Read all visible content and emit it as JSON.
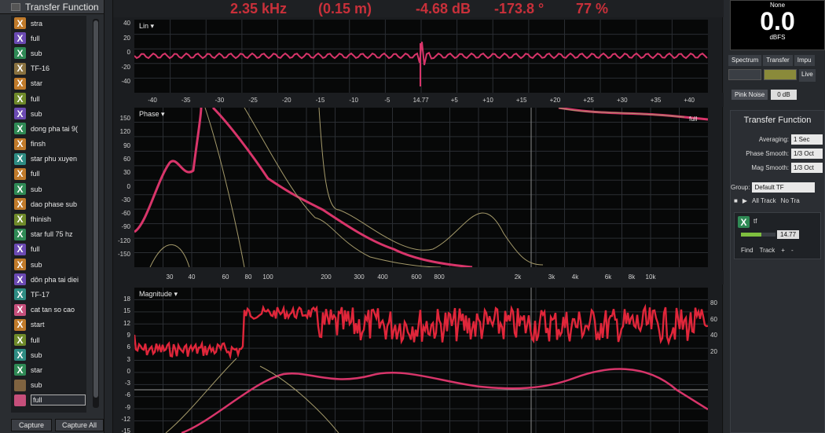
{
  "left_panel": {
    "title": "Transfer Function",
    "items": [
      {
        "icon": "X",
        "label": "stra",
        "color": "c-orange"
      },
      {
        "icon": "X",
        "label": "full",
        "color": "c-violet"
      },
      {
        "icon": "X",
        "label": "sub",
        "color": "c-green"
      },
      {
        "icon": "X",
        "label": "TF-16",
        "color": "c-sand"
      },
      {
        "icon": "X",
        "label": "star",
        "color": "c-orange"
      },
      {
        "icon": "X",
        "label": "full",
        "color": "c-olive"
      },
      {
        "icon": "X",
        "label": "sub",
        "color": "c-violet"
      },
      {
        "icon": "X",
        "label": "dong pha tai 9(",
        "color": "c-green"
      },
      {
        "icon": "X",
        "label": "finsh",
        "color": "c-orange"
      },
      {
        "icon": "X",
        "label": "star phu xuyen",
        "color": "c-teal"
      },
      {
        "icon": "X",
        "label": "full",
        "color": "c-orange"
      },
      {
        "icon": "X",
        "label": "sub",
        "color": "c-green"
      },
      {
        "icon": "X",
        "label": "dao phase sub",
        "color": "c-orange"
      },
      {
        "icon": "X",
        "label": "fhinish",
        "color": "c-olive"
      },
      {
        "icon": "X",
        "label": "star full 75 hz",
        "color": "c-green"
      },
      {
        "icon": "X",
        "label": "full",
        "color": "c-violet"
      },
      {
        "icon": "X",
        "label": "sub",
        "color": "c-orange"
      },
      {
        "icon": "X",
        "label": "dôn pha tai diei",
        "color": "c-violet"
      },
      {
        "icon": "X",
        "label": "TF-17",
        "color": "c-teal"
      },
      {
        "icon": "X",
        "label": "cat tan so cao",
        "color": "c-pink"
      },
      {
        "icon": "X",
        "label": "start",
        "color": "c-orange"
      },
      {
        "icon": "X",
        "label": "full",
        "color": "c-olive"
      },
      {
        "icon": "X",
        "label": "sub",
        "color": "c-teal"
      },
      {
        "icon": "X",
        "label": "star",
        "color": "c-green"
      },
      {
        "icon": "",
        "label": "sub",
        "color": "c-brown"
      },
      {
        "icon": "",
        "label": "full",
        "color": "c-pink",
        "selected": true
      }
    ],
    "capture_label": "Capture",
    "capture_all_label": "Capture All"
  },
  "readout": {
    "freq": "2.35 kHz",
    "dist": "(0.15 m)",
    "mag": "-4.68 dB",
    "phase": "-173.8 °",
    "coherence": "77 %"
  },
  "impulse": {
    "label": "Lin ▾",
    "y_ticks": [
      "40",
      "20",
      "0",
      "-20",
      "-40"
    ],
    "x_ticks": [
      "-40",
      "-35",
      "-30",
      "-25",
      "-20",
      "-15",
      "-10",
      "-5",
      "14.77",
      "+5",
      "+10",
      "+15",
      "+20",
      "+25",
      "+30",
      "+35",
      "+40"
    ]
  },
  "phase": {
    "label": "Phase ▾",
    "y_ticks": [
      "150",
      "120",
      "90",
      "60",
      "30",
      "0",
      "-30",
      "-60",
      "-90",
      "-120",
      "-150"
    ],
    "x_ticks": [
      "30",
      "40",
      "60",
      "80",
      "100",
      "200",
      "300",
      "400",
      "600",
      "800",
      "2k",
      "3k",
      "4k",
      "6k",
      "8k",
      "10k"
    ],
    "trace_label": "full"
  },
  "magnitude": {
    "label": "Magnitude ▾",
    "y_ticks": [
      "18",
      "15",
      "12",
      "9",
      "6",
      "3",
      "0",
      "-3",
      "-6",
      "-9",
      "-12",
      "-15"
    ],
    "y_ticks_right": [
      "80",
      "60",
      "40",
      "20"
    ]
  },
  "right_panel": {
    "meter_top": "None",
    "meter_value": "0.0",
    "meter_unit": "dBFS",
    "tabs": [
      "Spectrum",
      "Transfer",
      "Impu"
    ],
    "live_label": "Live",
    "pink_noise_label": "Pink Noise",
    "pink_noise_value": "0 dB",
    "tf_title": "Transfer Function",
    "averaging_label": "Averaging:",
    "averaging_value": "1 Sec",
    "phase_smooth_label": "Phase Smooth:",
    "phase_smooth_value": "1/3 Oct",
    "mag_smooth_label": "Mag Smooth:",
    "mag_smooth_value": "1/3 Oct",
    "group_label": "Group:",
    "group_value": "Default TF",
    "all_track_label": "All Track",
    "no_track_label": "No Tra",
    "track_name": "tf",
    "track_delay": "14.77",
    "find_label": "Find",
    "track_label": "Track",
    "plus_label": "+",
    "minus_label": "-"
  },
  "colors": {
    "trace_red": "#e0263a",
    "trace_pink": "#d8356a",
    "coherence": "#a59a6a",
    "readout": "#c9303a"
  }
}
